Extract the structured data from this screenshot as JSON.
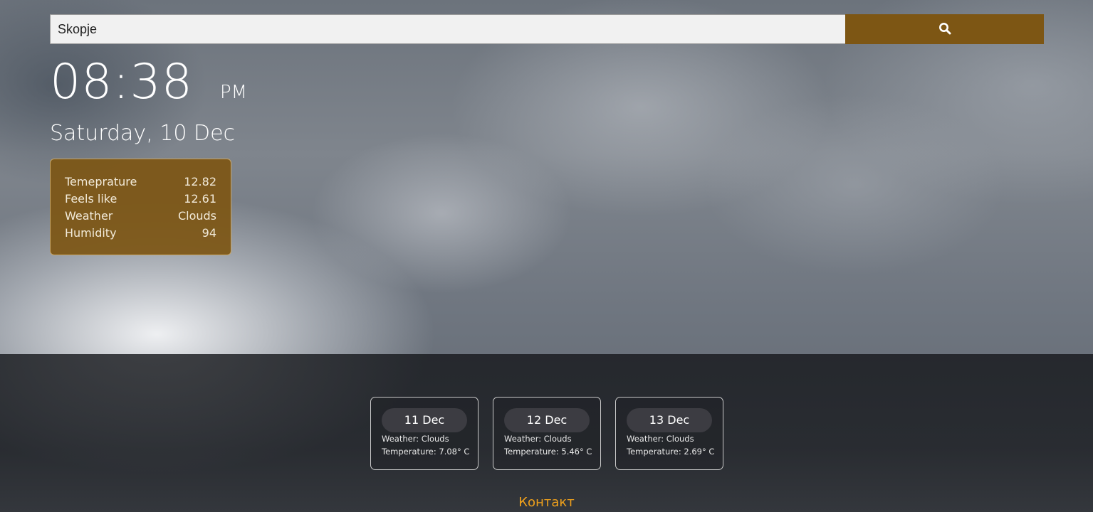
{
  "search": {
    "value": "Skopje",
    "placeholder": ""
  },
  "icons": {
    "search_button": "search-icon"
  },
  "clock": {
    "time": "08:38",
    "ampm": "PM"
  },
  "date": "Saturday, 10 Dec",
  "stats": [
    {
      "label": "Temeprature",
      "value": "12.82"
    },
    {
      "label": "Feels like",
      "value": "12.61"
    },
    {
      "label": "Weather",
      "value": "Clouds"
    },
    {
      "label": "Humidity",
      "value": "94"
    }
  ],
  "forecast": [
    {
      "day": "11 Dec",
      "weather": "Weather: Clouds",
      "temperature": "Temperature: 7.08° C"
    },
    {
      "day": "12 Dec",
      "weather": "Weather: Clouds",
      "temperature": "Temperature: 5.46° C"
    },
    {
      "day": "13 Dec",
      "weather": "Weather: Clouds",
      "temperature": "Temperature: 2.69° C"
    }
  ],
  "footer": {
    "contact": "Контакт"
  },
  "colors": {
    "accent": "#7d5614",
    "card_border": "#c6a567",
    "contact_link": "#f0a11c"
  }
}
